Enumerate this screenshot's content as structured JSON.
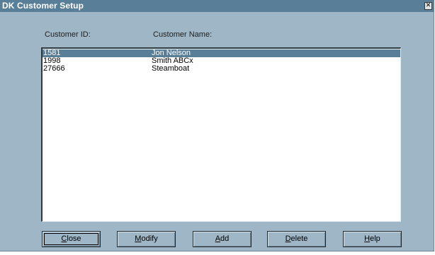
{
  "window": {
    "title": "DK Customer Setup",
    "close_glyph": "✕"
  },
  "list": {
    "headers": {
      "customer_id": "Customer ID:",
      "customer_name": "Customer Name:"
    },
    "rows": [
      {
        "id": "1581",
        "name": "Jon Nelson",
        "selected": true
      },
      {
        "id": "1998",
        "name": "Smith ABCx",
        "selected": false
      },
      {
        "id": "27666",
        "name": "Steamboat",
        "selected": false
      }
    ]
  },
  "buttons": [
    {
      "name": "close-button",
      "mnemonic": "C",
      "rest": "lose"
    },
    {
      "name": "modify-button",
      "mnemonic": "M",
      "rest": "odify"
    },
    {
      "name": "add-button",
      "mnemonic": "A",
      "rest": "dd"
    },
    {
      "name": "delete-button",
      "mnemonic": "D",
      "rest": "elete"
    },
    {
      "name": "help-button",
      "mnemonic": "H",
      "rest": "elp"
    }
  ],
  "colors": {
    "window_bg": "#9eb6c6",
    "titlebar_bg": "#597e97",
    "selection_bg": "#597e97"
  }
}
